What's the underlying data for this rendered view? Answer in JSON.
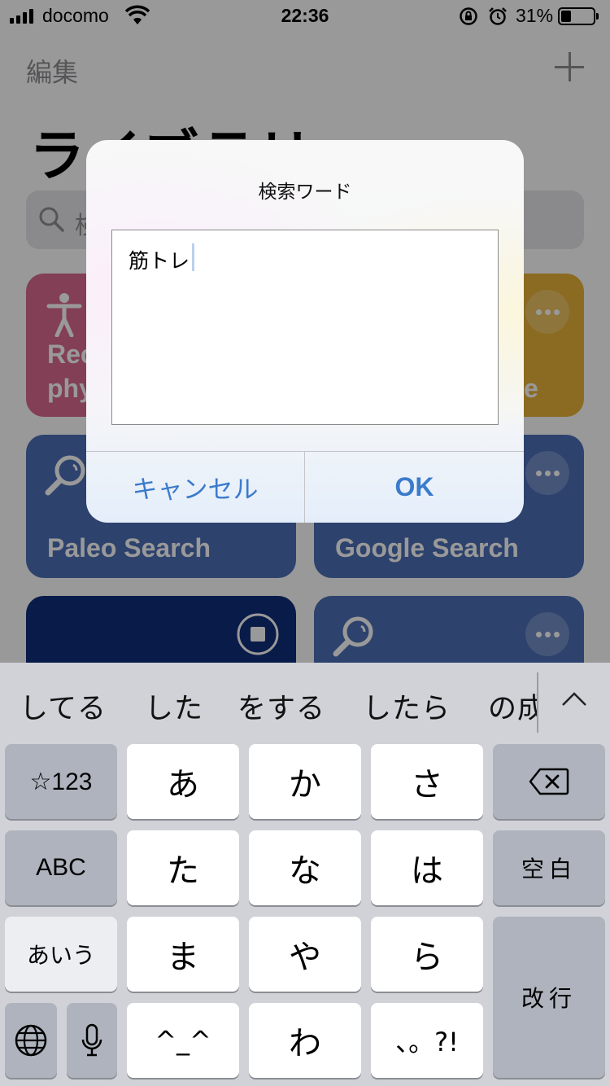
{
  "status_bar": {
    "carrier": "docomo",
    "time": "22:36",
    "battery_percent": "31%",
    "battery_level": 0.31
  },
  "nav": {
    "edit_label": "編集"
  },
  "page": {
    "title": "ライブラリ"
  },
  "search": {
    "placeholder": "検索"
  },
  "cards": [
    {
      "title": "Rec\nphy",
      "color": "#d96a8e",
      "icon": "accessibility-icon"
    },
    {
      "title": "e",
      "color": "#e8b33a",
      "icon": "none"
    },
    {
      "title": "Paleo Search",
      "color": "#4b6fb6",
      "icon": "magnifier-icon"
    },
    {
      "title": "Google Search",
      "color": "#4b6fb6",
      "icon": "magnifier-icon"
    },
    {
      "title": "",
      "color": "#0f2d7a",
      "icon": "stop-icon"
    },
    {
      "title": "",
      "color": "#4b6fb6",
      "icon": "magnifier-icon"
    }
  ],
  "alert": {
    "title": "検索ワード",
    "input_value": "筋トレ",
    "cancel_label": "キャンセル",
    "ok_label": "OK"
  },
  "keyboard": {
    "candidates": [
      "してる",
      "した",
      "をする",
      "したら",
      "の成"
    ],
    "keys": {
      "sym": "☆123",
      "a": "あ",
      "ka": "か",
      "sa": "さ",
      "abc": "ABC",
      "ta": "た",
      "na": "な",
      "ha": "は",
      "space": "空白",
      "kana": "あいう",
      "ma": "ま",
      "ya": "や",
      "ra": "ら",
      "return": "改行",
      "emoticon": "^_^",
      "wa": "わ",
      "punct": "、。?!"
    },
    "accent_color": "#3b7bcc"
  }
}
